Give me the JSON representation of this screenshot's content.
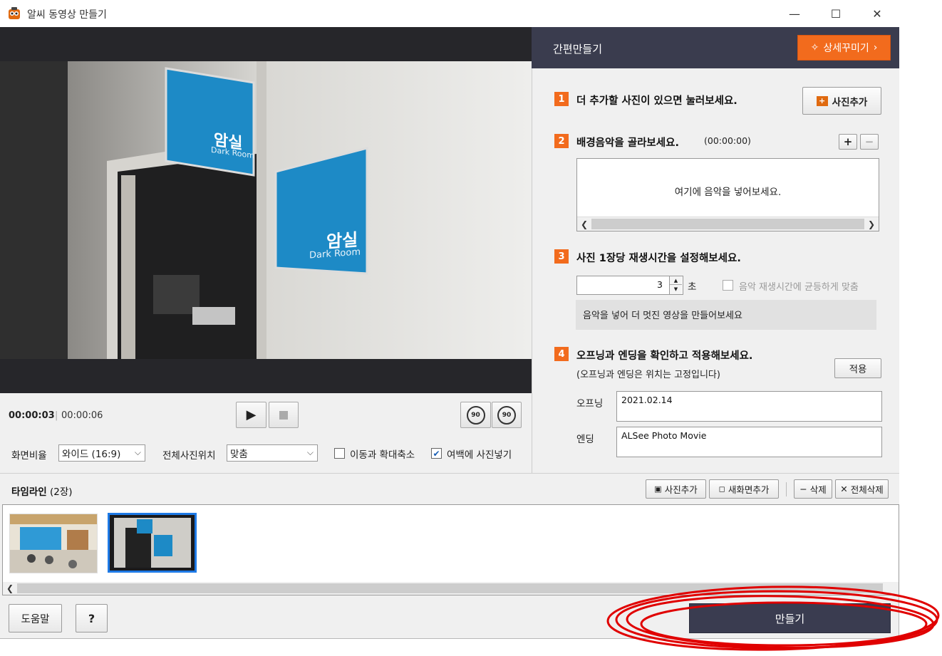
{
  "window": {
    "title": "알씨 동영상 만들기",
    "controls": {
      "minimize": "—",
      "maximize": "☐",
      "close": "✕"
    }
  },
  "player": {
    "current_time": "00:00:03",
    "separator": "|",
    "total_time": "00:00:06",
    "rotate_left_label": "90",
    "rotate_right_label": "90"
  },
  "options": {
    "ratio_label": "화면비율",
    "ratio_value": "와이드 (16:9)",
    "position_label": "전체사진위치",
    "position_value": "맞춤",
    "move_zoom_label": "이동과 확대축소",
    "move_zoom_checked": false,
    "margin_label": "여백에 사진넣기",
    "margin_checked": true
  },
  "photo_signs": [
    {
      "main": "암실",
      "sub": "Dark Room"
    },
    {
      "main": "암실",
      "sub": "Dark Room"
    }
  ],
  "right_panel": {
    "title": "간편만들기",
    "detail_button": "상세꾸미기",
    "step1": {
      "num": "1",
      "text": "더 추가할 사진이 있으면 눌러보세요.",
      "button": "사진추가"
    },
    "step2": {
      "num": "2",
      "text": "배경음악을 골라보세요.",
      "duration": "(00:00:00)",
      "add": "+",
      "remove": "−",
      "music_hint": "여기에 음악을 넣어보세요."
    },
    "step3": {
      "num": "3",
      "text": "사진 1장당 재생시간을 설정해보세요.",
      "seconds_value": "3",
      "seconds_unit": "초",
      "sync_label": "음악 재생시간에 균등하게 맞춤",
      "tip": "음악을 넣어 더 멋진 영상을 만들어보세요"
    },
    "step4": {
      "num": "4",
      "text": "오프닝과 엔딩을 확인하고 적용해보세요.",
      "subtext": "(오프닝과 엔딩은 위치는 고정입니다)",
      "apply_button": "적용",
      "opening_label": "오프닝",
      "opening_value": "2021.02.14",
      "ending_label": "엔딩",
      "ending_value": "ALSee Photo Movie"
    }
  },
  "timeline": {
    "title": "타임라인",
    "count": "(2장)",
    "add_photo": "사진추가",
    "add_screen": "새화면추가",
    "delete": "삭제",
    "delete_all": "전체삭제"
  },
  "bottom": {
    "help_button": "도움말",
    "question_button": "?",
    "make_button": "만들기"
  },
  "colors": {
    "accent": "#f26b1d",
    "header": "#3a3c4e",
    "make_button": "#3a3c50",
    "annotation": "#e00000"
  }
}
